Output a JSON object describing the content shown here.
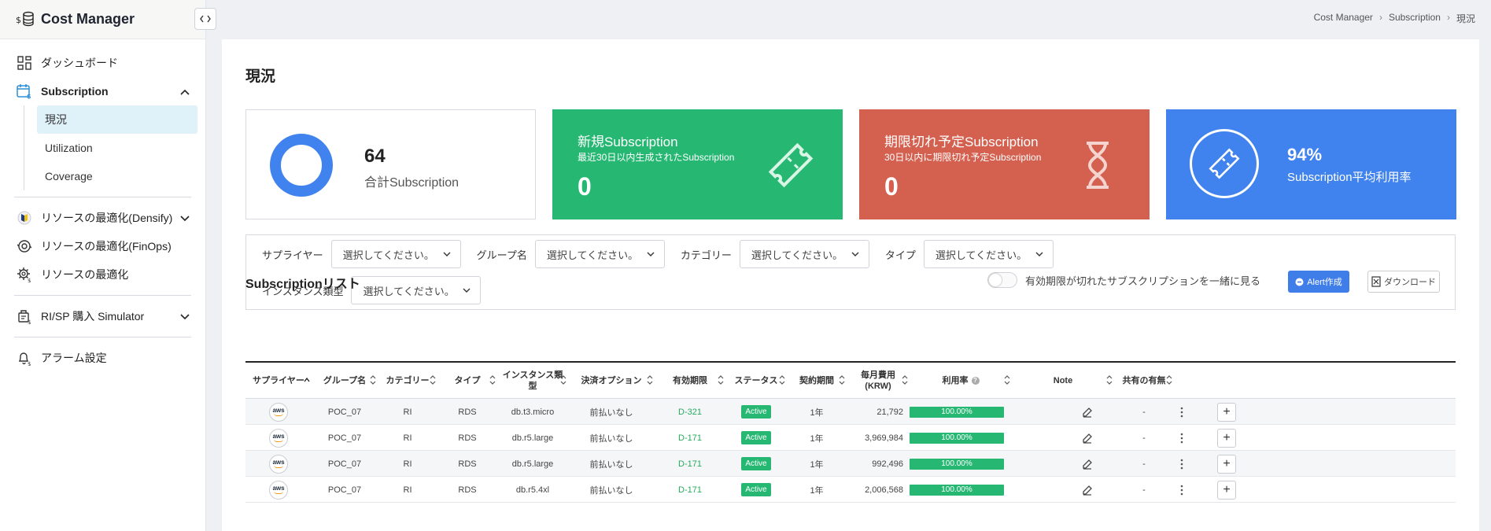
{
  "app": {
    "title": "Cost Manager",
    "collapse_icon": "code-brackets-icon"
  },
  "sidebar": {
    "items": [
      {
        "label": "ダッシュボード",
        "icon": "dashboard-grid-icon"
      },
      {
        "label": "Subscription",
        "icon": "calendar-dollar-icon"
      },
      {
        "label": "リソースの最適化(Densify)",
        "icon": "densify-icon"
      },
      {
        "label": "リソースの最適化(FinOps)",
        "icon": "finops-icon"
      },
      {
        "label": "リソースの最適化",
        "icon": "gear-dollar-icon"
      },
      {
        "label": "RI/SP 購入 Simulator",
        "icon": "simulator-icon"
      },
      {
        "label": "アラーム設定",
        "icon": "bell-dollar-icon"
      }
    ],
    "sub_items": [
      "現況",
      "Utilization",
      "Coverage"
    ]
  },
  "breadcrumb": [
    "Cost Manager",
    "Subscription",
    "現況"
  ],
  "page": {
    "title": "現況"
  },
  "cards": {
    "total": {
      "value": "64",
      "label": "合計Subscription"
    },
    "new": {
      "title": "新規Subscription",
      "subtitle": "最近30日以内生成されたSubscription",
      "value": "0"
    },
    "expiring": {
      "title": "期限切れ予定Subscription",
      "subtitle": "30日以内に期限切れ予定Subscription",
      "value": "0"
    },
    "utilization": {
      "value": "94%",
      "label": "Subscription平均利用率"
    }
  },
  "filters": {
    "supplier_label": "サプライヤー",
    "group_label": "グループ名",
    "category_label": "カテゴリー",
    "type_label": "タイプ",
    "instance_label": "インスタンス類型",
    "placeholder": "選択してください。"
  },
  "list": {
    "title": "Subscriptionリスト",
    "toggle_label": "有効期限が切れたサブスクリプションを一緒に見る",
    "alert_button": "Alert作成",
    "download_button": "ダウンロード"
  },
  "table": {
    "headers": {
      "supplier": "サプライヤー",
      "group": "グループ名",
      "category": "カテゴリー",
      "type": "タイプ",
      "instance_a": "インスタンス類",
      "instance_b": "型",
      "payment": "決済オプション",
      "expiry": "有効期限",
      "status": "ステータス",
      "term": "契約期間",
      "monthly_a": "毎月費用",
      "monthly_b": "(KRW)",
      "util": "利用率",
      "note": "Note",
      "shared": "共有の有無"
    },
    "rows": [
      {
        "supplier": "aws",
        "group": "POC_07",
        "category": "RI",
        "type": "RDS",
        "instance": "db.t3.micro",
        "payment": "前払いなし",
        "expiry": "D-321",
        "status": "Active",
        "term": "1年",
        "monthly": "21,792",
        "util": "100.00%",
        "util_value": 100,
        "shared": "-"
      },
      {
        "supplier": "aws",
        "group": "POC_07",
        "category": "RI",
        "type": "RDS",
        "instance": "db.r5.large",
        "payment": "前払いなし",
        "expiry": "D-171",
        "status": "Active",
        "term": "1年",
        "monthly": "3,969,984",
        "util": "100.00%",
        "util_value": 100,
        "shared": "-"
      },
      {
        "supplier": "aws",
        "group": "POC_07",
        "category": "RI",
        "type": "RDS",
        "instance": "db.r5.large",
        "payment": "前払いなし",
        "expiry": "D-171",
        "status": "Active",
        "term": "1年",
        "monthly": "992,496",
        "util": "100.00%",
        "util_value": 100,
        "shared": "-"
      },
      {
        "supplier": "aws",
        "group": "POC_07",
        "category": "RI",
        "type": "RDS",
        "instance": "db.r5.4xl",
        "payment": "前払いなし",
        "expiry": "D-171",
        "status": "Active",
        "term": "1年",
        "monthly": "2,006,568",
        "util": "100.00%",
        "util_value": 100,
        "shared": "-"
      }
    ]
  },
  "colors": {
    "green": "#26b873",
    "red": "#d4604f",
    "blue": "#4183ee"
  }
}
